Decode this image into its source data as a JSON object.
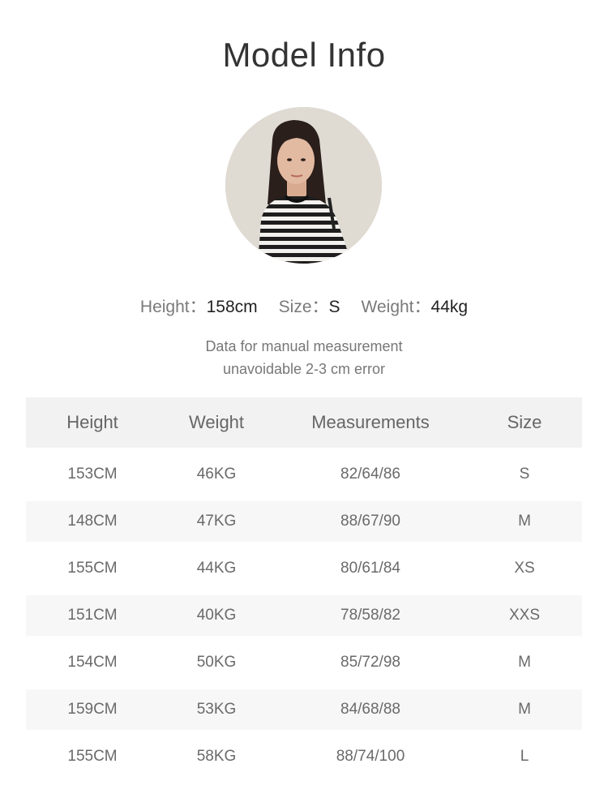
{
  "title": "Model Info",
  "avatar": {
    "icon": "model-photo"
  },
  "model_stats": {
    "height_label": "Height：",
    "height_value": "158cm",
    "size_label": "Size：",
    "size_value": "S",
    "weight_label": "Weight：",
    "weight_value": "44kg"
  },
  "note": {
    "line1": "Data for manual measurement",
    "line2": "unavoidable 2-3 cm error"
  },
  "table": {
    "headers": [
      "Height",
      "Weight",
      "Measurements",
      "Size"
    ],
    "rows": [
      [
        "153CM",
        "46KG",
        "82/64/86",
        "S"
      ],
      [
        "148CM",
        "47KG",
        "88/67/90",
        "M"
      ],
      [
        "155CM",
        "44KG",
        "80/61/84",
        "XS"
      ],
      [
        "151CM",
        "40KG",
        "78/58/82",
        "XXS"
      ],
      [
        "154CM",
        "50KG",
        "85/72/98",
        "M"
      ],
      [
        "159CM",
        "53KG",
        "84/68/88",
        "M"
      ],
      [
        "155CM",
        "58KG",
        "88/74/100",
        "L"
      ]
    ]
  }
}
